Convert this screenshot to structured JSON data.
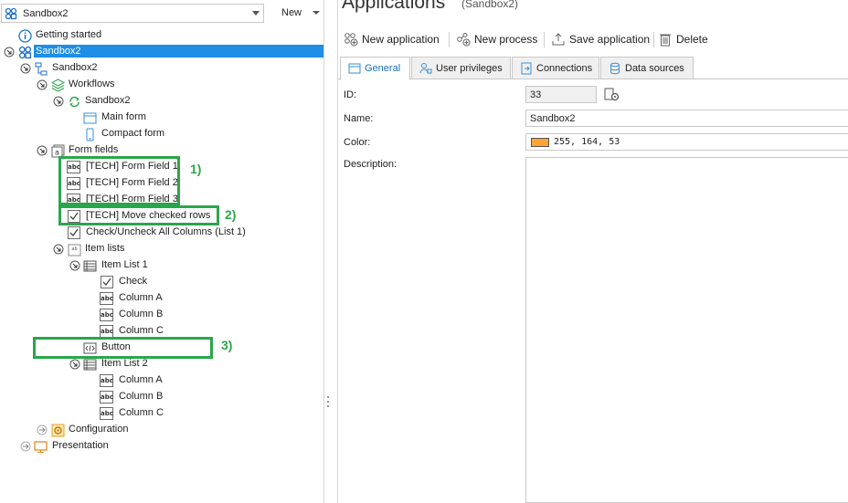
{
  "top_bar": {
    "app_name": "Sandbox2",
    "new_label": "New"
  },
  "tree": {
    "getting_started": "Getting started",
    "root_sandbox": "Sandbox2",
    "sandbox_child": "Sandbox2",
    "workflows": "Workflows",
    "workflow_sandbox": "Sandbox2",
    "main_form": "Main form",
    "compact_form": "Compact form",
    "form_fields": "Form fields",
    "field1": "[TECH] Form Field 1",
    "field2": "[TECH] Form Field 2",
    "field3": "[TECH] Form Field 3",
    "move_checked": "[TECH] Move checked rows",
    "check_uncheck": "Check/Uncheck All Columns (List 1)",
    "item_lists": "Item lists",
    "item_list1": "Item List 1",
    "il1_check": "Check",
    "il1_col_a": "Column A",
    "il1_col_b": "Column B",
    "il1_col_c": "Column C",
    "button": "Button",
    "item_list2": "Item List 2",
    "il2_col_a": "Column A",
    "il2_col_b": "Column B",
    "il2_col_c": "Column C",
    "configuration": "Configuration",
    "presentation": "Presentation"
  },
  "annotations": {
    "a1": "1)",
    "a2": "2)",
    "a3": "3)",
    "color": "#2aa64a"
  },
  "main": {
    "title": "Applications",
    "subtitle": "(Sandbox2)",
    "toolbar": {
      "new_application": "New application",
      "new_process": "New process",
      "save_application": "Save application",
      "delete": "Delete"
    },
    "tabs": [
      "General",
      "User privileges",
      "Connections",
      "Data sources"
    ],
    "form": {
      "id_label": "ID:",
      "id_value": "33",
      "name_label": "Name:",
      "name_value": "Sandbox2",
      "color_label": "Color:",
      "color_value": "255, 164, 53",
      "color_swatch": "#ffa435",
      "description_label": "Description:",
      "description_value": ""
    }
  },
  "colors": {
    "selection": "#1e8ee6",
    "active_tab_text": "#1a6fb8"
  }
}
